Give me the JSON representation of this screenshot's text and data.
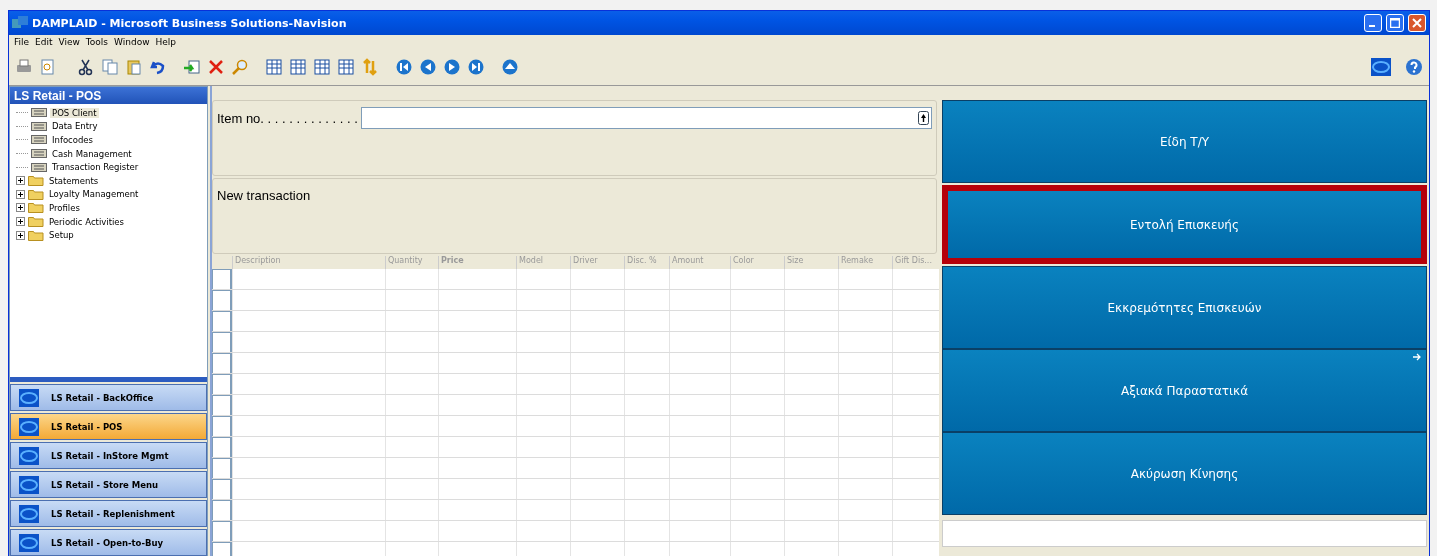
{
  "window": {
    "title": "DAMPLAID - Microsoft Business Solutions-Navision"
  },
  "menu": [
    "File",
    "Edit",
    "View",
    "Tools",
    "Window",
    "Help"
  ],
  "navigation": {
    "title": "LS Retail - POS",
    "tree": [
      {
        "kind": "form",
        "label": "POS Client",
        "selected": true
      },
      {
        "kind": "form",
        "label": "Data Entry",
        "selected": false
      },
      {
        "kind": "form",
        "label": "Infocodes",
        "selected": false
      },
      {
        "kind": "form",
        "label": "Cash Management",
        "selected": false
      },
      {
        "kind": "form",
        "label": "Transaction Register",
        "selected": false
      },
      {
        "kind": "folder",
        "label": "Statements",
        "selected": false,
        "expanded": false
      },
      {
        "kind": "folder",
        "label": "Loyalty Management",
        "selected": false,
        "expanded": false
      },
      {
        "kind": "folder",
        "label": "Profiles",
        "selected": false,
        "expanded": false
      },
      {
        "kind": "folder",
        "label": "Periodic Activities",
        "selected": false,
        "expanded": false
      },
      {
        "kind": "folder",
        "label": "Setup",
        "selected": false,
        "expanded": false
      }
    ],
    "shortcuts": [
      {
        "label": "LS Retail - BackOffice",
        "selected": false
      },
      {
        "label": "LS Retail - POS",
        "selected": true
      },
      {
        "label": "LS Retail - InStore Mgmt",
        "selected": false
      },
      {
        "label": "LS Retail - Store Menu",
        "selected": false
      },
      {
        "label": "LS Retail - Replenishment",
        "selected": false
      },
      {
        "label": "LS Retail - Open-to-Buy",
        "selected": false
      }
    ]
  },
  "pos": {
    "item_label": "Item no. . . . . . . . . . . . . .",
    "status": "New transaction",
    "columns": [
      {
        "label": "Description",
        "bold": false
      },
      {
        "label": "Quantity",
        "bold": false
      },
      {
        "label": "Price",
        "bold": true
      },
      {
        "label": "Model",
        "bold": false
      },
      {
        "label": "Driver",
        "bold": false
      },
      {
        "label": "Disc. %",
        "bold": false
      },
      {
        "label": "Amount",
        "bold": false
      },
      {
        "label": "Color",
        "bold": false
      },
      {
        "label": "Size",
        "bold": false
      },
      {
        "label": "Remake",
        "bold": false
      },
      {
        "label": "Gift Dis...",
        "bold": false
      }
    ],
    "buttons": [
      {
        "label": "Είδη Τ/Υ",
        "selected": false,
        "submenu": false
      },
      {
        "label": "Εντολή Επισκευής",
        "selected": true,
        "submenu": false
      },
      {
        "label": "Εκκρεμότητες Επισκευών",
        "selected": false,
        "submenu": false
      },
      {
        "label": "Αξιακά Παραστατικά",
        "selected": false,
        "submenu": true
      },
      {
        "label": "Ακύρωση Κίνησης",
        "selected": false,
        "submenu": false
      }
    ]
  }
}
